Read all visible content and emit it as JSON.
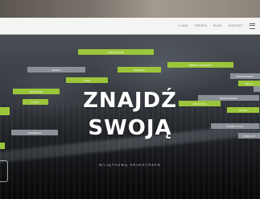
{
  "nav": {
    "items": [
      "O NAS",
      "OFERTA",
      "BLOG",
      "KONTAKT"
    ]
  },
  "hero": {
    "headline_line1": "ZNAJDŹ",
    "headline_line2": "SWOJĄ",
    "tagline": "WYJĄTKOWĄ PRZESTRZEŃ"
  },
  "tags": [
    {
      "label": "MIESZKANIE",
      "color": "#9bc63b"
    },
    {
      "label": "BIURO",
      "color": "#8b9096"
    },
    {
      "label": "DOM",
      "color": "#9bc63b"
    },
    {
      "label": "DZIAŁKA",
      "color": "#9bc63b"
    },
    {
      "label": "OBIEKT BIUROWY",
      "color": "#9bc63b"
    },
    {
      "label": "LOKAL",
      "color": "#9bc63b"
    },
    {
      "label": "APARTAMENT",
      "color": "#8b9096"
    },
    {
      "label": "CENTRUM",
      "color": "#9bc63b"
    },
    {
      "label": "MAGAZYN",
      "color": "#9bc63b"
    },
    {
      "label": "PRZESTRZEŃ",
      "color": "#8b9096"
    },
    {
      "label": "INWESTYCJA",
      "color": "#8b9096"
    },
    {
      "label": "KAMIENICA",
      "color": "#8b9096"
    },
    {
      "label": "WILLA",
      "color": "#9bc63b"
    },
    {
      "label": "PAWILON",
      "color": "#8b9096"
    },
    {
      "label": "NOWE",
      "color": "#9bc63b"
    }
  ]
}
